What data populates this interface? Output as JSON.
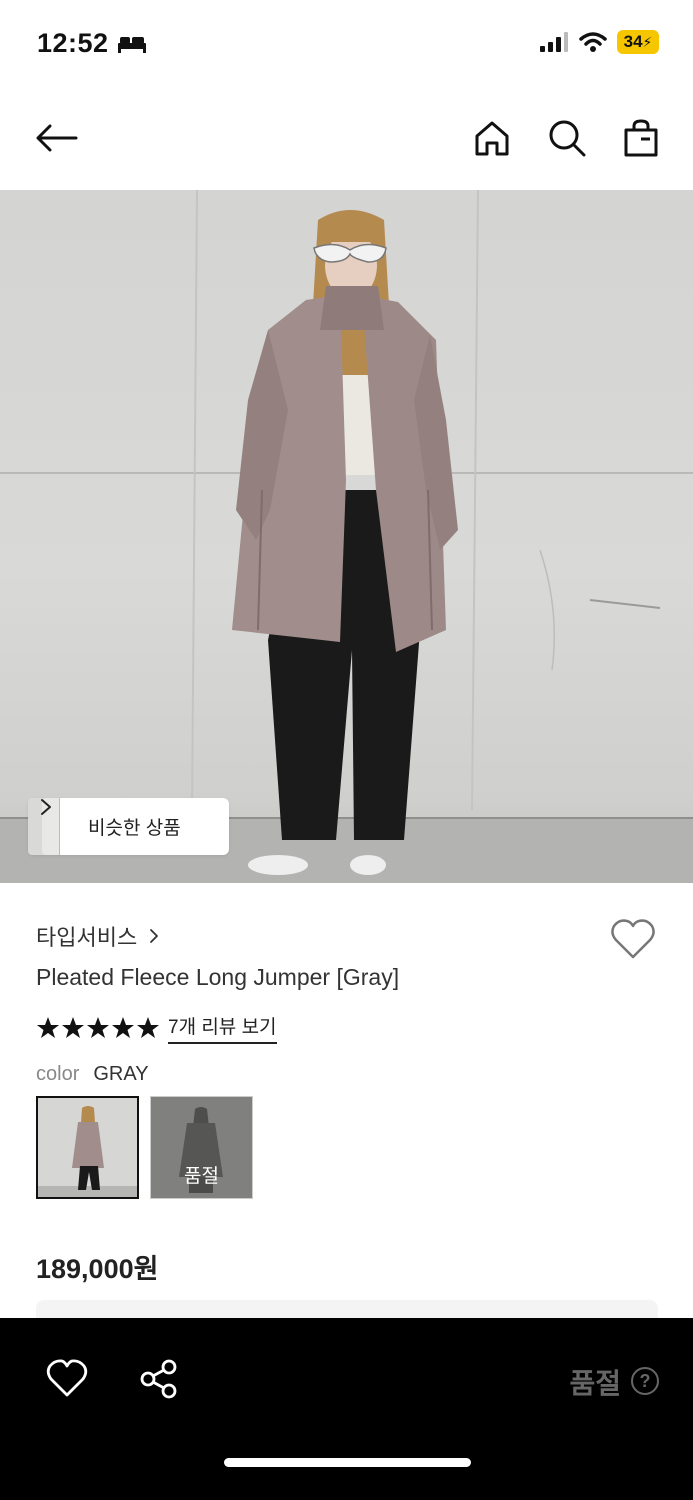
{
  "status": {
    "time": "12:52",
    "battery": "34"
  },
  "hero": {
    "similar_label": "비슷한 상품"
  },
  "product": {
    "brand": "타입서비스",
    "name": "Pleated Fleece Long Jumper [Gray]",
    "rating_stars": 5,
    "review_link": "7개 리뷰 보기",
    "color_label": "color",
    "color_value": "GRAY",
    "swatches": [
      {
        "state": "selected",
        "label": ""
      },
      {
        "state": "soldout",
        "label": "품절"
      }
    ],
    "price": "189,000원"
  },
  "bottom_bar": {
    "soldout_label": "품절",
    "help_glyph": "?"
  },
  "colors": {
    "accent_battery": "#f6c700",
    "bottom_bar_bg": "#000000",
    "soldout_text": "#666666"
  }
}
